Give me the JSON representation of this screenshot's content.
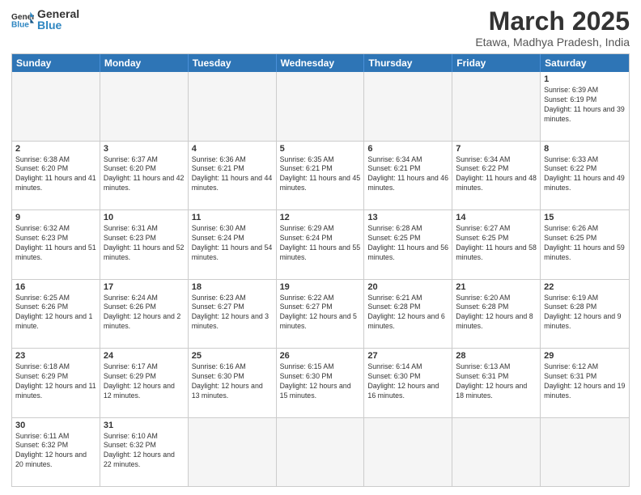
{
  "header": {
    "logo_general": "General",
    "logo_blue": "Blue",
    "month_title": "March 2025",
    "location": "Etawa, Madhya Pradesh, India"
  },
  "days_of_week": [
    "Sunday",
    "Monday",
    "Tuesday",
    "Wednesday",
    "Thursday",
    "Friday",
    "Saturday"
  ],
  "weeks": [
    [
      {
        "day": "",
        "empty": true
      },
      {
        "day": "",
        "empty": true
      },
      {
        "day": "",
        "empty": true
      },
      {
        "day": "",
        "empty": true
      },
      {
        "day": "",
        "empty": true
      },
      {
        "day": "",
        "empty": true
      },
      {
        "day": "1",
        "sunrise": "6:39 AM",
        "sunset": "6:19 PM",
        "daylight": "11 hours and 39 minutes."
      }
    ],
    [
      {
        "day": "2",
        "sunrise": "6:38 AM",
        "sunset": "6:20 PM",
        "daylight": "11 hours and 41 minutes."
      },
      {
        "day": "3",
        "sunrise": "6:37 AM",
        "sunset": "6:20 PM",
        "daylight": "11 hours and 42 minutes."
      },
      {
        "day": "4",
        "sunrise": "6:36 AM",
        "sunset": "6:21 PM",
        "daylight": "11 hours and 44 minutes."
      },
      {
        "day": "5",
        "sunrise": "6:35 AM",
        "sunset": "6:21 PM",
        "daylight": "11 hours and 45 minutes."
      },
      {
        "day": "6",
        "sunrise": "6:34 AM",
        "sunset": "6:21 PM",
        "daylight": "11 hours and 46 minutes."
      },
      {
        "day": "7",
        "sunrise": "6:34 AM",
        "sunset": "6:22 PM",
        "daylight": "11 hours and 48 minutes."
      },
      {
        "day": "8",
        "sunrise": "6:33 AM",
        "sunset": "6:22 PM",
        "daylight": "11 hours and 49 minutes."
      }
    ],
    [
      {
        "day": "9",
        "sunrise": "6:32 AM",
        "sunset": "6:23 PM",
        "daylight": "11 hours and 51 minutes."
      },
      {
        "day": "10",
        "sunrise": "6:31 AM",
        "sunset": "6:23 PM",
        "daylight": "11 hours and 52 minutes."
      },
      {
        "day": "11",
        "sunrise": "6:30 AM",
        "sunset": "6:24 PM",
        "daylight": "11 hours and 54 minutes."
      },
      {
        "day": "12",
        "sunrise": "6:29 AM",
        "sunset": "6:24 PM",
        "daylight": "11 hours and 55 minutes."
      },
      {
        "day": "13",
        "sunrise": "6:28 AM",
        "sunset": "6:25 PM",
        "daylight": "11 hours and 56 minutes."
      },
      {
        "day": "14",
        "sunrise": "6:27 AM",
        "sunset": "6:25 PM",
        "daylight": "11 hours and 58 minutes."
      },
      {
        "day": "15",
        "sunrise": "6:26 AM",
        "sunset": "6:25 PM",
        "daylight": "11 hours and 59 minutes."
      }
    ],
    [
      {
        "day": "16",
        "sunrise": "6:25 AM",
        "sunset": "6:26 PM",
        "daylight": "12 hours and 1 minute."
      },
      {
        "day": "17",
        "sunrise": "6:24 AM",
        "sunset": "6:26 PM",
        "daylight": "12 hours and 2 minutes."
      },
      {
        "day": "18",
        "sunrise": "6:23 AM",
        "sunset": "6:27 PM",
        "daylight": "12 hours and 3 minutes."
      },
      {
        "day": "19",
        "sunrise": "6:22 AM",
        "sunset": "6:27 PM",
        "daylight": "12 hours and 5 minutes."
      },
      {
        "day": "20",
        "sunrise": "6:21 AM",
        "sunset": "6:28 PM",
        "daylight": "12 hours and 6 minutes."
      },
      {
        "day": "21",
        "sunrise": "6:20 AM",
        "sunset": "6:28 PM",
        "daylight": "12 hours and 8 minutes."
      },
      {
        "day": "22",
        "sunrise": "6:19 AM",
        "sunset": "6:28 PM",
        "daylight": "12 hours and 9 minutes."
      }
    ],
    [
      {
        "day": "23",
        "sunrise": "6:18 AM",
        "sunset": "6:29 PM",
        "daylight": "12 hours and 11 minutes."
      },
      {
        "day": "24",
        "sunrise": "6:17 AM",
        "sunset": "6:29 PM",
        "daylight": "12 hours and 12 minutes."
      },
      {
        "day": "25",
        "sunrise": "6:16 AM",
        "sunset": "6:30 PM",
        "daylight": "12 hours and 13 minutes."
      },
      {
        "day": "26",
        "sunrise": "6:15 AM",
        "sunset": "6:30 PM",
        "daylight": "12 hours and 15 minutes."
      },
      {
        "day": "27",
        "sunrise": "6:14 AM",
        "sunset": "6:30 PM",
        "daylight": "12 hours and 16 minutes."
      },
      {
        "day": "28",
        "sunrise": "6:13 AM",
        "sunset": "6:31 PM",
        "daylight": "12 hours and 18 minutes."
      },
      {
        "day": "29",
        "sunrise": "6:12 AM",
        "sunset": "6:31 PM",
        "daylight": "12 hours and 19 minutes."
      }
    ],
    [
      {
        "day": "30",
        "sunrise": "6:11 AM",
        "sunset": "6:32 PM",
        "daylight": "12 hours and 20 minutes."
      },
      {
        "day": "31",
        "sunrise": "6:10 AM",
        "sunset": "6:32 PM",
        "daylight": "12 hours and 22 minutes."
      },
      {
        "day": "",
        "empty": true
      },
      {
        "day": "",
        "empty": true
      },
      {
        "day": "",
        "empty": true
      },
      {
        "day": "",
        "empty": true
      },
      {
        "day": "",
        "empty": true
      }
    ]
  ]
}
